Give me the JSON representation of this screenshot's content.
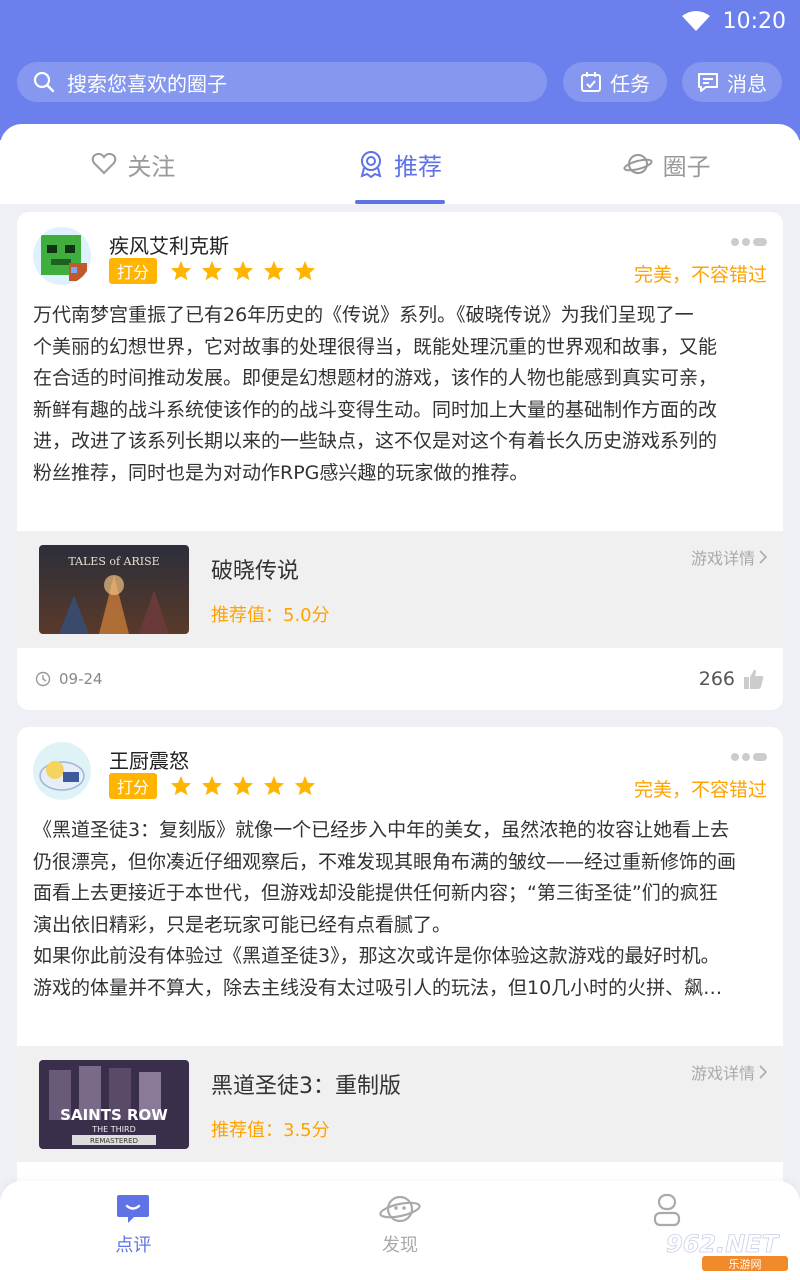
{
  "status": {
    "time": "10:20"
  },
  "search": {
    "placeholder": "搜索您喜欢的圈子"
  },
  "header_buttons": {
    "task_label": "任务",
    "message_label": "消息"
  },
  "tabs": [
    {
      "label": "关注",
      "icon": "heart-icon"
    },
    {
      "label": "推荐",
      "icon": "ribbon-icon",
      "active": true
    },
    {
      "label": "圈子",
      "icon": "planet-icon"
    }
  ],
  "reviews": [
    {
      "username": "疾风艾利克斯",
      "tag": "打分",
      "stars": 5,
      "rating_text": "完美，不容错过",
      "body": "万代南梦宫重振了已有26年历史的《传说》系列。《破晓传说》为我们呈现了一\n个美丽的幻想世界，它对故事的处理很得当，既能处理沉重的世界观和故事，又能\n在合适的时间推动发展。即便是幻想题材的游戏，该作的人物也能感到真实可亲，\n新鲜有趣的战斗系统使该作的的战斗变得生动。同时加上大量的基础制作方面的改\n进，改进了该系列长期以来的一些缺点，这不仅是对这个有着长久历史游戏系列的\n粉丝推荐，同时也是为对动作RPG感兴趣的玩家做的推荐。",
      "game": {
        "name": "破晓传说",
        "score": "推荐值：5.0分",
        "detail": "游戏详情",
        "cover_text": "TALES of ARISE"
      },
      "date": "09-24",
      "likes": "266"
    },
    {
      "username": "王厨震怒",
      "tag": "打分",
      "stars": 5,
      "rating_text": "完美，不容错过",
      "body": "《黑道圣徒3：复刻版》就像一个已经步入中年的美女，虽然浓艳的妆容让她看上去\n仍很漂亮，但你凑近仔细观察后，不难发现其眼角布满的皱纹——经过重新修饰的画\n面看上去更接近于本世代，但游戏却没能提供任何新内容；“第三街圣徒”们的疯狂\n演出依旧精彩，只是老玩家可能已经有点看腻了。\n如果你此前没有体验过《黑道圣徒3》，那这次或许是你体验这款游戏的最好时机。\n游戏的体量并不算大，除去主线没有太过吸引人的玩法，但10几小时的火拼、飙…",
      "game": {
        "name": "黑道圣徒3：重制版",
        "score": "推荐值：3.5分",
        "detail": "游戏详情",
        "cover_text": "SAINTS ROW",
        "cover_sub": "THE THIRD",
        "cover_sub2": "REMASTERED"
      }
    }
  ],
  "bottom_nav": [
    {
      "label": "点评",
      "icon": "chat-bubble-icon",
      "active": true
    },
    {
      "label": "发现",
      "icon": "planet-icon"
    },
    {
      "label": "",
      "icon": "user-icon"
    }
  ],
  "watermark": {
    "text": "962.NET",
    "sub": "乐游网"
  },
  "colors": {
    "primary": "#6b80ec",
    "accent": "#5f72e6",
    "gold": "#ffa200",
    "tag": "#ffb400"
  }
}
